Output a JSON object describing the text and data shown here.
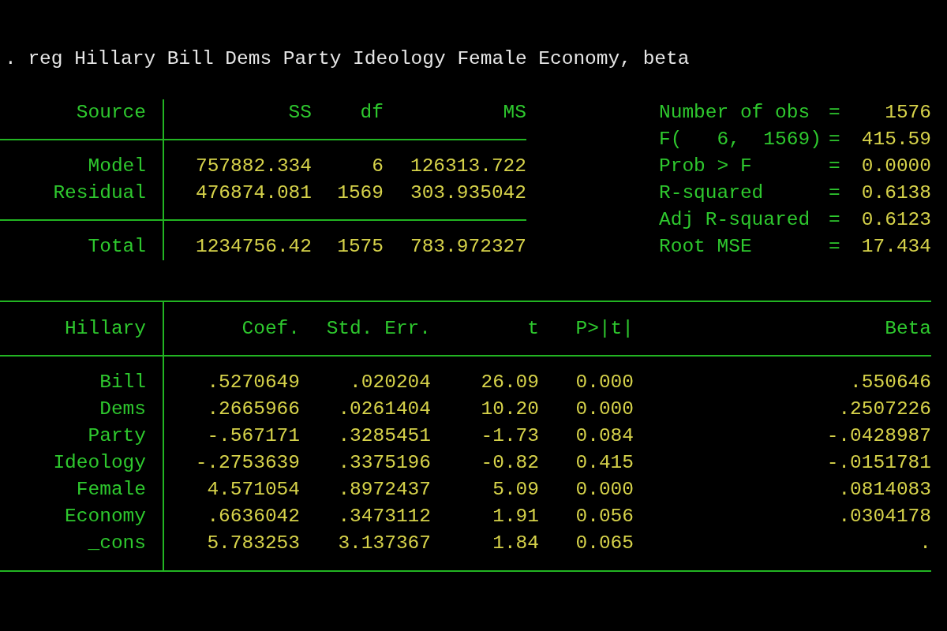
{
  "command": ". reg Hillary Bill Dems Party Ideology Female Economy, beta",
  "anova": {
    "columns": [
      "Source",
      "SS",
      "df",
      "MS"
    ],
    "rows": [
      [
        "Model",
        "757882.334",
        "6",
        "126313.722"
      ],
      [
        "Residual",
        "476874.081",
        "1569",
        "303.935042"
      ]
    ],
    "total": [
      "Total",
      "1234756.42",
      "1575",
      "783.972327"
    ]
  },
  "stats": [
    {
      "label": "Number of obs",
      "sign": "=",
      "value": "1576"
    },
    {
      "label": "F(   6,  1569)",
      "sign": "=",
      "value": "415.59"
    },
    {
      "label": "Prob > F",
      "sign": "=",
      "value": "0.0000"
    },
    {
      "label": "R-squared",
      "sign": "=",
      "value": "0.6138"
    },
    {
      "label": "Adj R-squared",
      "sign": "=",
      "value": "0.6123"
    },
    {
      "label": "Root MSE",
      "sign": "=",
      "value": "17.434"
    }
  ],
  "coefficients": {
    "columns": [
      "Hillary",
      "Coef.",
      "Std. Err.",
      "t",
      "P>|t|",
      "Beta"
    ],
    "rows": [
      [
        "Bill",
        ".5270649",
        ".020204",
        "26.09",
        "0.000",
        ".550646"
      ],
      [
        "Dems",
        ".2665966",
        ".0261404",
        "10.20",
        "0.000",
        ".2507226"
      ],
      [
        "Party",
        "-.567171",
        ".3285451",
        "-1.73",
        "0.084",
        "-.0428987"
      ],
      [
        "Ideology",
        "-.2753639",
        ".3375196",
        "-0.82",
        "0.415",
        "-.0151781"
      ],
      [
        "Female",
        "4.571054",
        ".8972437",
        "5.09",
        "0.000",
        ".0814083"
      ],
      [
        "Economy",
        ".6636042",
        ".3473112",
        "1.91",
        "0.056",
        ".0304178"
      ],
      [
        "_cons",
        "5.783253",
        "3.137367",
        "1.84",
        "0.065",
        "."
      ]
    ]
  }
}
